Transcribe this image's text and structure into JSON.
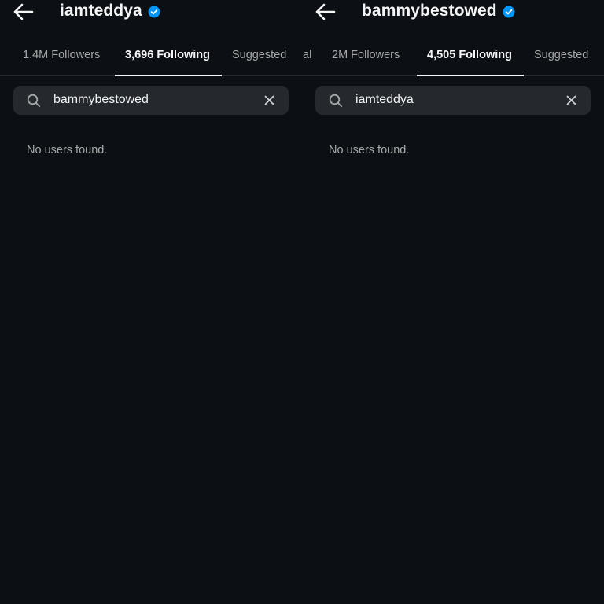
{
  "colors": {
    "background": "#0c1014",
    "search_bg": "#25292e",
    "verified_badge": "#0095f6",
    "muted_text": "#a8a8a8",
    "primary_text": "#f5f5f5"
  },
  "icons": {
    "back": "arrow-left-icon",
    "verified": "verified-badge-icon",
    "search": "search-icon",
    "clear": "close-icon"
  },
  "left": {
    "username": "iamteddya",
    "tabs": {
      "edge": "l",
      "followers": "1.4M Followers",
      "following": "3,696 Following",
      "suggested": "Suggested"
    },
    "search": {
      "value": "bammybestowed"
    },
    "empty_message": "No users found."
  },
  "right": {
    "username": "bammybestowed",
    "tabs": {
      "edge": "al",
      "followers": "2M Followers",
      "following": "4,505 Following",
      "suggested": "Suggested"
    },
    "search": {
      "value": "iamteddya"
    },
    "empty_message": "No users found."
  }
}
